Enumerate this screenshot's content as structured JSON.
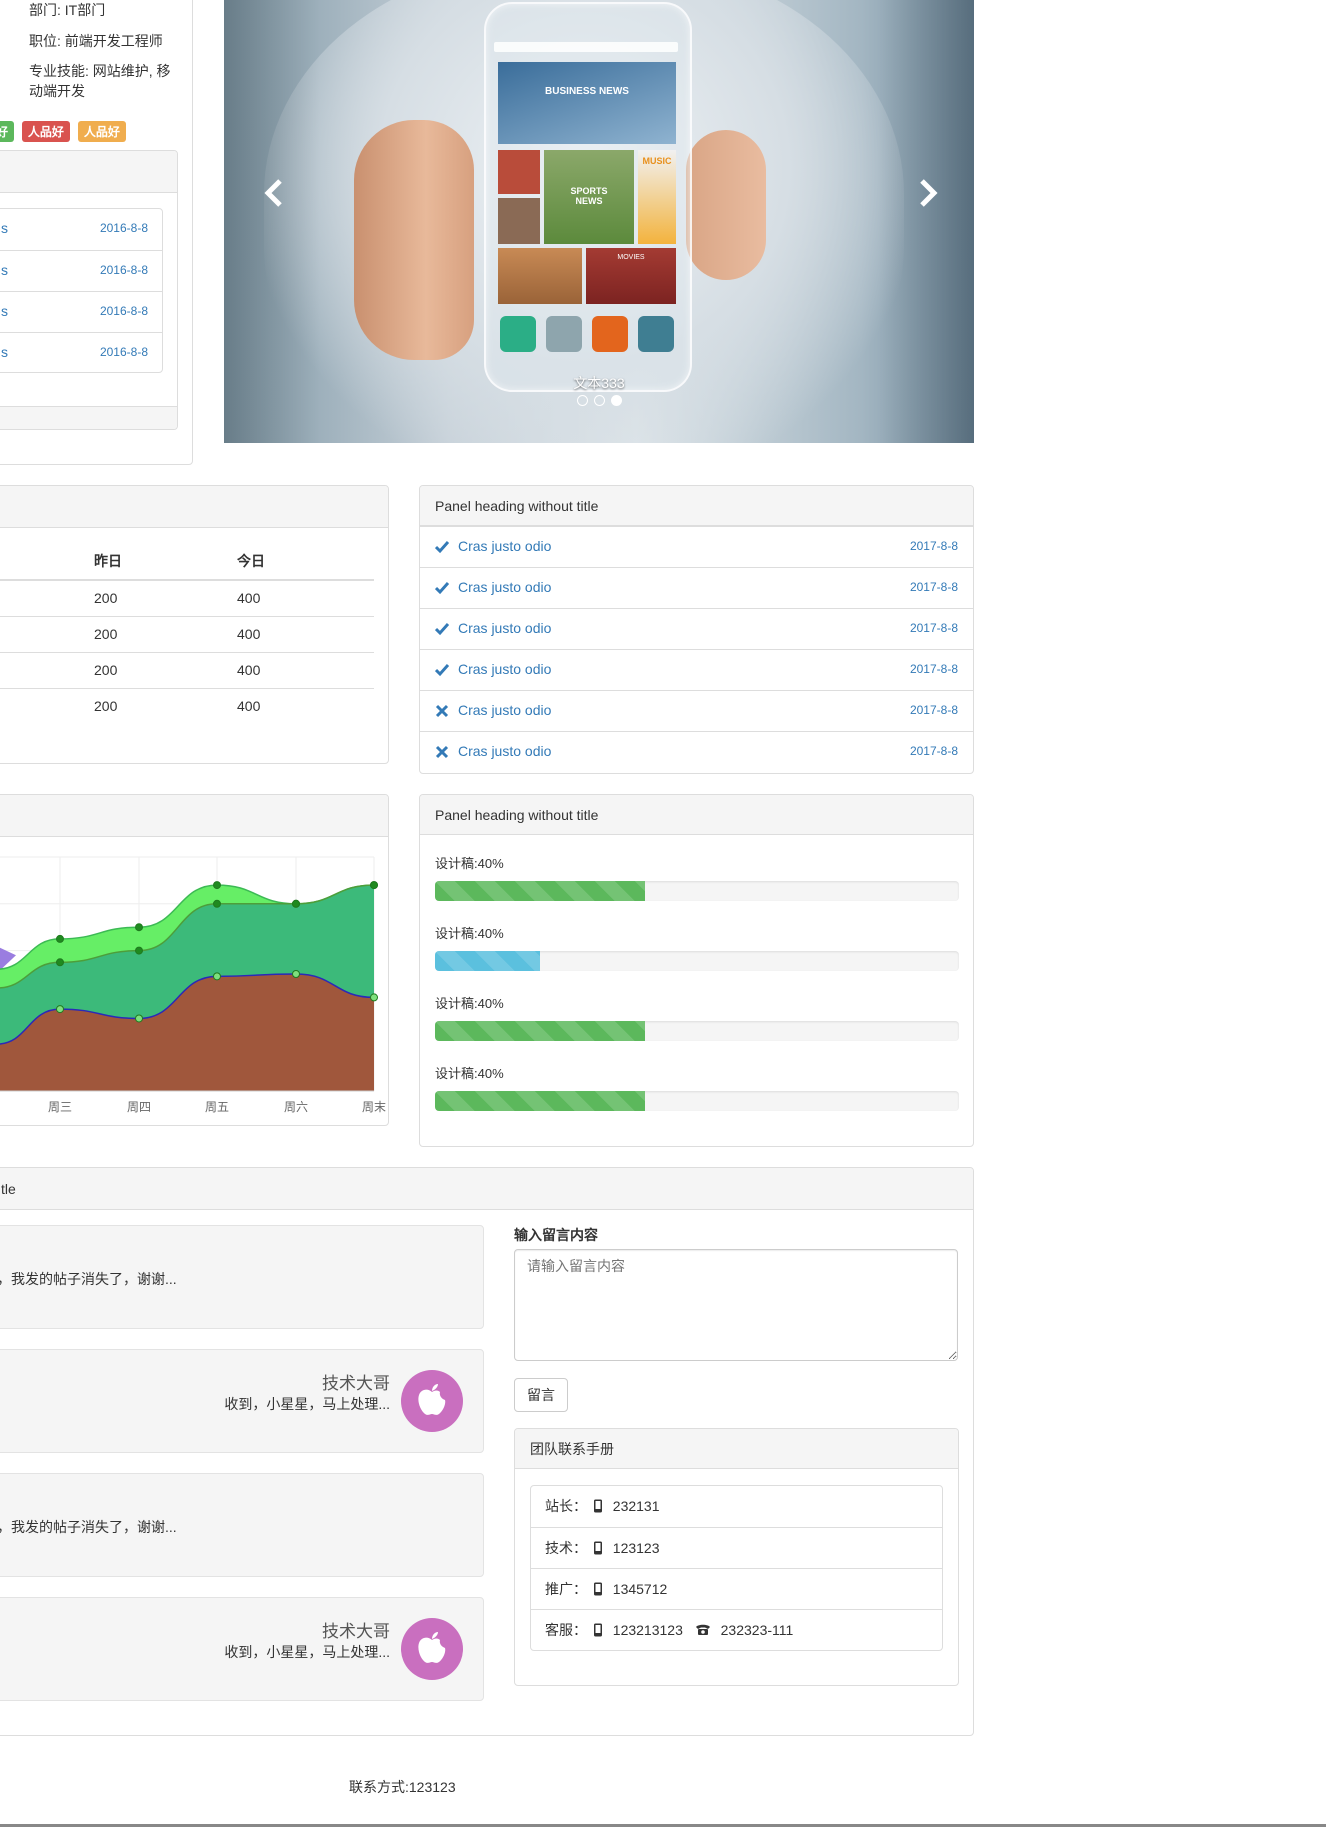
{
  "profile": {
    "department": "部门: IT部门",
    "position": "职位: 前端开发工程师",
    "skills_line1": "专业技能: 网站维护, 移",
    "skills_line2": "动端开发",
    "tags": [
      {
        "text": "好",
        "color": "#5cb85c"
      },
      {
        "text": "人品好",
        "color": "#d9534f"
      },
      {
        "text": "人品好",
        "color": "#f0ad4e"
      }
    ]
  },
  "notice_panel": {
    "dates": [
      "2016-8-8",
      "2016-8-8",
      "2016-8-8",
      "2016-8-8"
    ]
  },
  "carousel": {
    "caption": "文本333",
    "prev_icon": "chevron-left-icon",
    "next_icon": "chevron-right-icon",
    "active_index": 2,
    "indicator_count": 3,
    "phone_texts": {
      "business": "BUSINESS NEWS",
      "sports": "SPORTS NEWS",
      "music": "MUSIC",
      "movies": "MOVIES"
    }
  },
  "stats_table": {
    "headers": [
      "昨日",
      "今日"
    ],
    "rows": [
      [
        "200",
        "400"
      ],
      [
        "200",
        "400"
      ],
      [
        "200",
        "400"
      ],
      [
        "200",
        "400"
      ]
    ]
  },
  "task_panel": {
    "heading": "Panel heading without title",
    "items": [
      {
        "icon": "check-icon",
        "text": "Cras justo odio",
        "date": "2017-8-8"
      },
      {
        "icon": "check-icon",
        "text": "Cras justo odio",
        "date": "2017-8-8"
      },
      {
        "icon": "check-icon",
        "text": "Cras justo odio",
        "date": "2017-8-8"
      },
      {
        "icon": "check-icon",
        "text": "Cras justo odio",
        "date": "2017-8-8"
      },
      {
        "icon": "close-icon",
        "text": "Cras justo odio",
        "date": "2017-8-8"
      },
      {
        "icon": "close-icon",
        "text": "Cras justo odio",
        "date": "2017-8-8"
      }
    ]
  },
  "progress_panel": {
    "heading": "Panel heading without title",
    "items": [
      {
        "label": "设计稿:40%",
        "value": 0.4,
        "color": "#5cb85c"
      },
      {
        "label": "设计稿:40%",
        "value": 0.2,
        "color": "#5bc0de"
      },
      {
        "label": "设计稿:40%",
        "value": 0.4,
        "color": "#5cb85c"
      },
      {
        "label": "设计稿:40%",
        "value": 0.4,
        "color": "#5cb85c"
      }
    ]
  },
  "chart_data": {
    "type": "area",
    "categories": [
      "周三",
      "周四",
      "周五",
      "周六",
      "周末"
    ],
    "ylim": [
      0,
      100
    ],
    "grid": true,
    "series": [
      {
        "values": [
          65,
          70,
          88,
          80,
          88
        ],
        "color": "#66ee66"
      },
      {
        "values": [
          55,
          60,
          80,
          80,
          88
        ],
        "color": "#3cba7a"
      },
      {
        "values": [
          35,
          31,
          49,
          50,
          40
        ],
        "color": "#a0573c"
      }
    ]
  },
  "messages_panel": {
    "heading": "tle",
    "messages": [
      {
        "type": "user",
        "text": "，我发的帖子消失了，谢谢..."
      },
      {
        "type": "admin",
        "name": "技术大哥",
        "text": "收到，小星星，马上处理...",
        "avatar_icon": "apple-icon"
      },
      {
        "type": "user",
        "text": "，我发的帖子消失了，谢谢..."
      },
      {
        "type": "admin",
        "name": "技术大哥",
        "text": "收到，小星星，马上处理...",
        "avatar_icon": "apple-icon"
      }
    ],
    "form_label": "输入留言内容",
    "textarea_placeholder": "请输入留言内容",
    "submit_label": "留言"
  },
  "contacts_panel": {
    "heading": "团队联系手册",
    "rows": [
      {
        "label": "站长：",
        "mobile": "232131"
      },
      {
        "label": "技术：",
        "mobile": "123123"
      },
      {
        "label": "推广：",
        "mobile": "1345712"
      },
      {
        "label": "客服：",
        "mobile": "123213123",
        "phone": "232323-111"
      }
    ]
  },
  "footer": {
    "contact": "联系方式:123123"
  }
}
